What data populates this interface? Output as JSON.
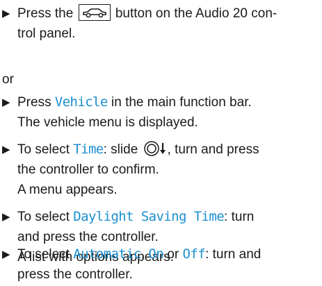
{
  "steps": [
    {
      "arrow": "▶",
      "parts": [
        "Press the",
        "button on the Audio 20 con-",
        "trol panel."
      ],
      "icon": "car-button-icon"
    },
    {
      "arrow": "▶",
      "parts": [
        "Press",
        "Vehicle",
        "in the main function bar.",
        "The vehicle menu is displayed."
      ]
    },
    {
      "arrow": "▶",
      "parts": [
        "To select",
        "Time",
        ": slide",
        ", turn and press",
        "the controller to confirm.",
        "A menu appears."
      ],
      "icon": "controller-slide-down-icon"
    },
    {
      "arrow": "▶",
      "parts": [
        "To select",
        "Daylight Saving Time",
        ": turn",
        "and press the controller.",
        "A list with options appears."
      ]
    },
    {
      "arrow": "▶",
      "parts": [
        "To select",
        "Automatic",
        ",",
        "On",
        "or",
        "Off",
        ": turn and",
        "press the controller."
      ]
    }
  ],
  "or_text": "or",
  "colors": {
    "accent": "#1b8fd0",
    "text": "#1a1a1a"
  }
}
